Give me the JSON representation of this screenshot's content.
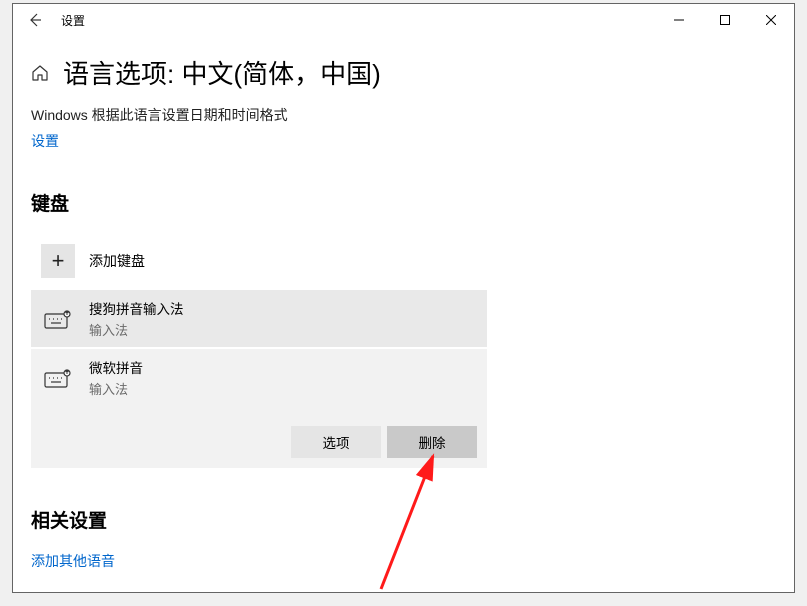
{
  "window": {
    "title": "设置"
  },
  "page": {
    "title": "语言选项: 中文(简体，中国)",
    "info": "Windows 根据此语言设置日期和时间格式",
    "settings_link": "设置"
  },
  "keyboard": {
    "heading": "键盘",
    "add_label": "添加键盘",
    "imes": [
      {
        "name": "搜狗拼音输入法",
        "sub": "输入法"
      },
      {
        "name": "微软拼音",
        "sub": "输入法"
      }
    ],
    "actions": {
      "options": "选项",
      "delete": "删除"
    }
  },
  "related": {
    "heading": "相关设置",
    "link": "添加其他语音"
  }
}
